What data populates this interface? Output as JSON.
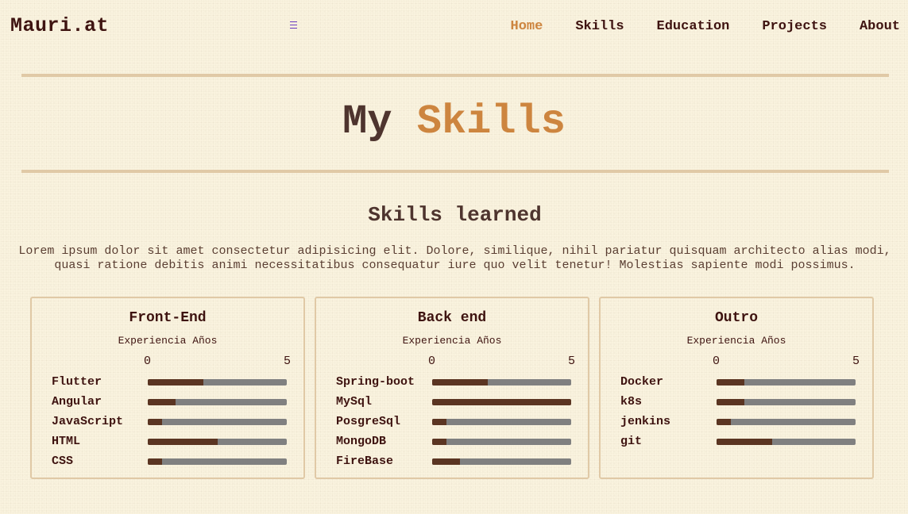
{
  "header": {
    "brand": "Mauri.at",
    "nav": [
      {
        "label": "Home",
        "active": true
      },
      {
        "label": "Skills",
        "active": false
      },
      {
        "label": "Education",
        "active": false
      },
      {
        "label": "Projects",
        "active": false
      },
      {
        "label": "About",
        "active": false
      }
    ]
  },
  "hero": {
    "title_prefix": "My",
    "title_accent": "Skills"
  },
  "section": {
    "title": "Skills learned",
    "description": "Lorem ipsum dolor sit amet consectetur adipisicing elit. Dolore, similique, nihil pariatur quisquam architecto alias modi, quasi ratione debitis animi necessitatibus consequatur iure quo velit tenetur! Molestias sapiente modi possimus."
  },
  "cards": [
    {
      "title": "Front-End",
      "subtitle": "Experiencia Años",
      "scale_min": "0",
      "scale_max": "5",
      "skills": [
        {
          "name": "Flutter",
          "level": 2.0
        },
        {
          "name": "Angular",
          "level": 1.0
        },
        {
          "name": "JavaScript",
          "level": 0.5
        },
        {
          "name": "HTML",
          "level": 2.5
        },
        {
          "name": "CSS",
          "level": 0.5
        }
      ]
    },
    {
      "title": "Back end",
      "subtitle": "Experiencia Años",
      "scale_min": "0",
      "scale_max": "5",
      "skills": [
        {
          "name": "Spring-boot",
          "level": 2.0
        },
        {
          "name": "MySql",
          "level": 5.0
        },
        {
          "name": "PosgreSql",
          "level": 0.5
        },
        {
          "name": "MongoDB",
          "level": 0.5
        },
        {
          "name": "FireBase",
          "level": 1.0
        }
      ]
    },
    {
      "title": "Outro",
      "subtitle": "Experiencia Años",
      "scale_min": "0",
      "scale_max": "5",
      "skills": [
        {
          "name": "Docker",
          "level": 1.0
        },
        {
          "name": "k8s",
          "level": 1.0
        },
        {
          "name": "jenkins",
          "level": 0.5
        },
        {
          "name": "git",
          "level": 2.0
        }
      ]
    }
  ],
  "colors": {
    "accent": "#cd853f",
    "bar_fill": "#5b3522",
    "bar_track": "#808080",
    "divider": "#e0c9a6"
  },
  "icons": {
    "menu": "hamburger-menu-icon"
  }
}
